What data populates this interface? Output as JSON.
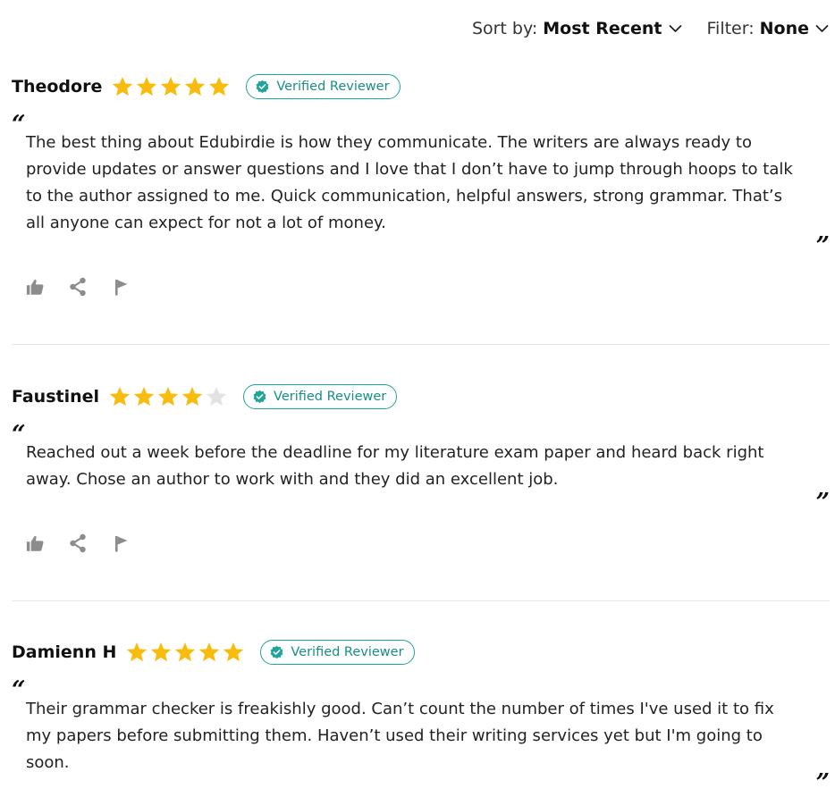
{
  "toolbar": {
    "sort_label": "Sort by:",
    "sort_value": "Most Recent",
    "filter_label": "Filter:",
    "filter_value": "None"
  },
  "colors": {
    "star_filled": "#f8bc0e",
    "star_empty": "#e3e3e3",
    "badge_accent": "#1fa49a",
    "action_icon": "#8c8c8c"
  },
  "reviews": [
    {
      "name": "Theodore",
      "rating": 5,
      "badge": "Verified Reviewer",
      "quote_open": "“",
      "quote_close": "”",
      "text": "The best thing about Edubirdie is how they communicate. The writers are always ready to provide updates or answer questions and I love that I don’t have to jump through hoops to talk to the author assigned to me. Quick communication, helpful answers, strong grammar. That’s all anyone can expect for not a lot of money."
    },
    {
      "name": "Faustinel",
      "rating": 4,
      "badge": "Verified Reviewer",
      "quote_open": "“",
      "quote_close": "”",
      "text": "Reached out a week before the deadline for my literature exam paper and heard back right away. Chose an author to work with and they did an excellent job."
    },
    {
      "name": "Damienn H",
      "rating": 5,
      "badge": "Verified Reviewer",
      "quote_open": "“",
      "quote_close": "”",
      "text": "Their grammar checker is freakishly good. Can’t count the number of times I've used it to fix my papers before submitting them. Haven’t used their writing services yet but I'm going to soon."
    }
  ],
  "icons": {
    "like": "thumbs-up-icon",
    "share": "share-icon",
    "report": "flag-icon",
    "verified": "verified-check-icon",
    "chevron": "chevron-down-icon",
    "star": "star-icon"
  }
}
